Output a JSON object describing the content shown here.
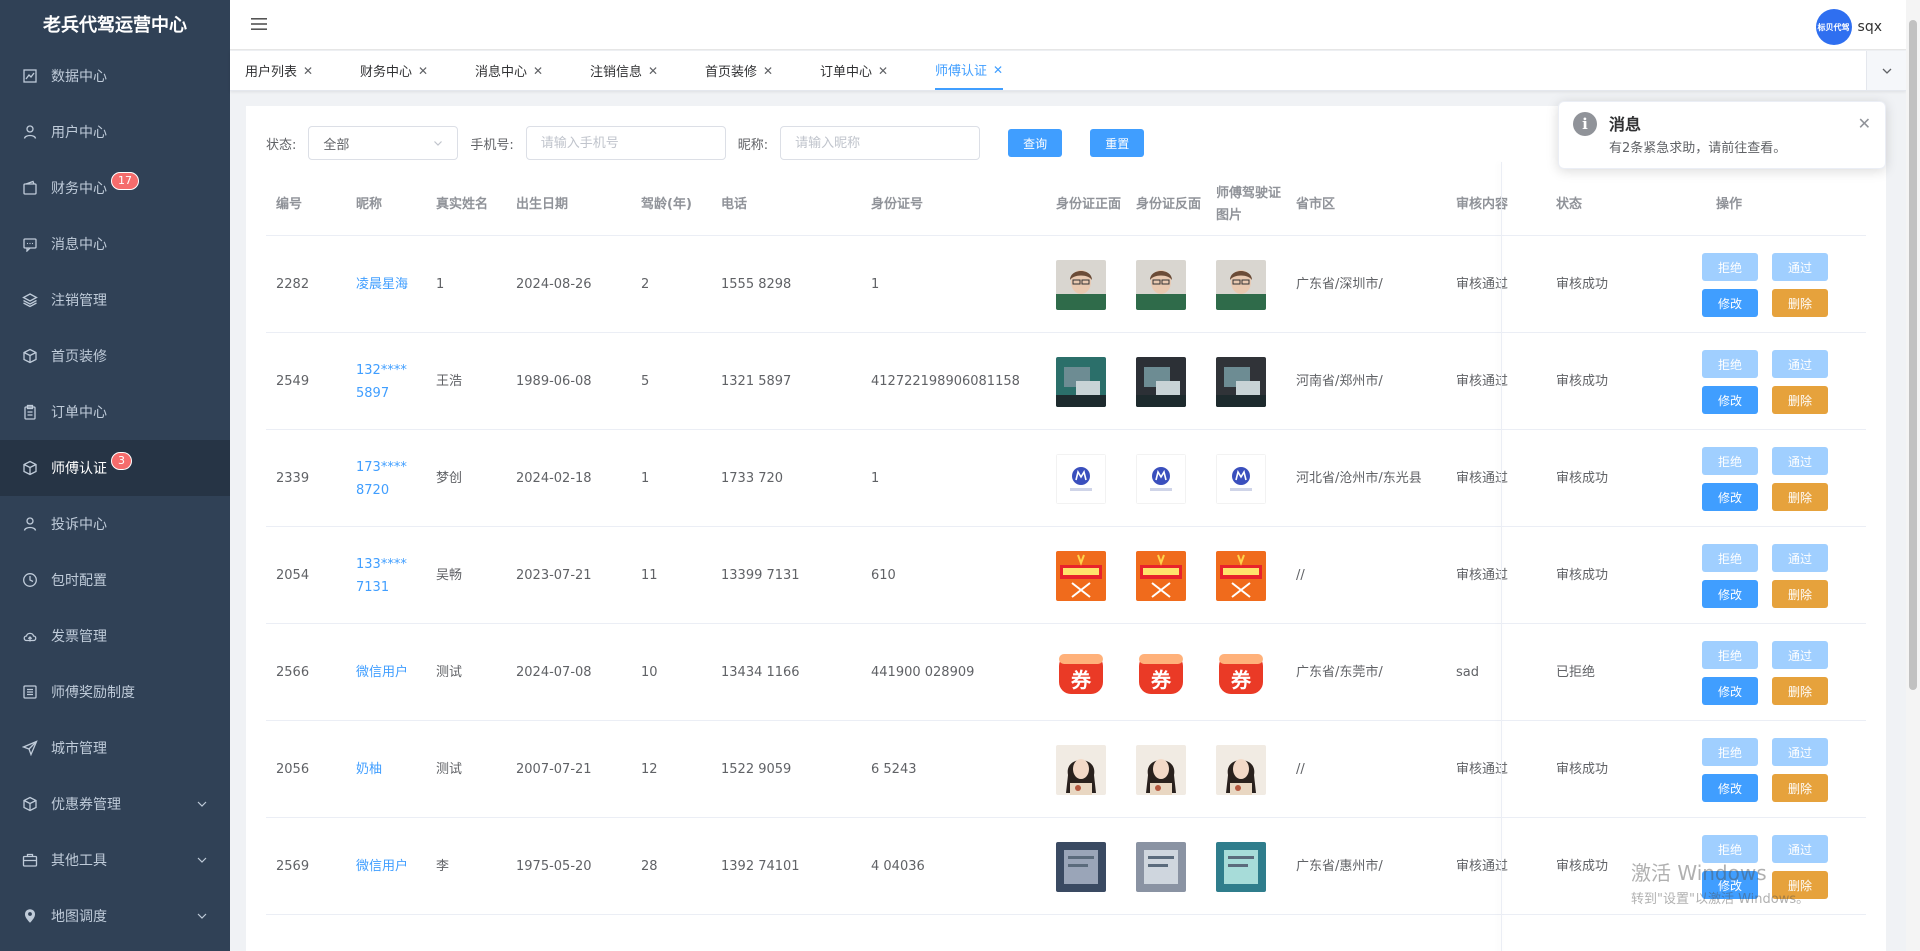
{
  "sidebar": {
    "logo": "老兵代驾运营中心",
    "items": [
      {
        "label": "数据中心",
        "icon": "chart-icon"
      },
      {
        "label": "用户中心",
        "icon": "user-icon"
      },
      {
        "label": "财务中心",
        "icon": "wallet-icon",
        "badge": "17"
      },
      {
        "label": "消息中心",
        "icon": "message-icon"
      },
      {
        "label": "注销管理",
        "icon": "layers-icon"
      },
      {
        "label": "首页装修",
        "icon": "box-icon"
      },
      {
        "label": "订单中心",
        "icon": "clipboard-icon"
      },
      {
        "label": "师傅认证",
        "icon": "box-icon",
        "badge": "3"
      },
      {
        "label": "投诉中心",
        "icon": "user-icon"
      },
      {
        "label": "包时配置",
        "icon": "clock-icon"
      },
      {
        "label": "发票管理",
        "icon": "cloud-icon"
      },
      {
        "label": "师傅奖励制度",
        "icon": "list-icon"
      },
      {
        "label": "城市管理",
        "icon": "send-icon"
      },
      {
        "label": "优惠券管理",
        "icon": "box-icon"
      },
      {
        "label": "其他工具",
        "icon": "briefcase-icon"
      },
      {
        "label": "地图调度",
        "icon": "location-icon"
      }
    ]
  },
  "header": {
    "username": "sqx",
    "avatar_text": "标贝代驾"
  },
  "tabs": [
    {
      "label": "用户列表"
    },
    {
      "label": "财务中心"
    },
    {
      "label": "消息中心"
    },
    {
      "label": "注销信息"
    },
    {
      "label": "首页装修"
    },
    {
      "label": "订单中心"
    },
    {
      "label": "师傅认证"
    }
  ],
  "filter": {
    "status_label": "状态:",
    "status_value": "全部",
    "phone_label": "手机号:",
    "phone_placeholder": "请输入手机号",
    "nick_label": "昵称:",
    "nick_placeholder": "请输入昵称",
    "query_btn": "查询",
    "reset_btn": "重置"
  },
  "table": {
    "columns": [
      "编号",
      "昵称",
      "真实姓名",
      "出生日期",
      "驾龄(年)",
      "电话",
      "身份证号",
      "身份证正面",
      "身份证反面",
      "师傅驾驶证图片",
      "省市区",
      "审核内容",
      "状态",
      "操作"
    ],
    "actions": {
      "reject": "拒绝",
      "pass": "通过",
      "edit": "修改",
      "delete": "删除"
    },
    "rows": [
      {
        "id": "2282",
        "nick": "凌晨星海",
        "name": "1",
        "birth": "2024-08-26",
        "years": "2",
        "phone": "1555  8298",
        "idno": "1",
        "region": "广东省/深圳市/",
        "review": "审核通过",
        "status": "审核成功",
        "img": "portrait"
      },
      {
        "id": "2549",
        "nick": "132****5897",
        "name": "王浩",
        "birth": "1989-06-08",
        "years": "5",
        "phone": "1321  5897",
        "idno": "412722198906081158",
        "region": "河南省/郑州市/",
        "review": "审核通过",
        "status": "审核成功",
        "img": "photo"
      },
      {
        "id": "2339",
        "nick": "173****8720",
        "name": "梦创",
        "birth": "2024-02-18",
        "years": "1",
        "phone": "1733  720",
        "idno": "1",
        "region": "河北省/沧州市/东光县",
        "review": "审核通过",
        "status": "审核成功",
        "img": "logo"
      },
      {
        "id": "2054",
        "nick": "133****7131",
        "name": "吴畅",
        "birth": "2023-07-21",
        "years": "11",
        "phone": "13399  7131",
        "idno": "610",
        "region": "//",
        "review": "审核通过",
        "status": "审核成功",
        "img": "poster"
      },
      {
        "id": "2566",
        "nick": "微信用户",
        "name": "测试",
        "birth": "2024-07-08",
        "years": "10",
        "phone": "13434  1166",
        "idno": "441900  028909",
        "region": "广东省/东莞市/",
        "review": "sad",
        "status": "已拒绝",
        "img": "coupon"
      },
      {
        "id": "2056",
        "nick": "奶柚",
        "name": "测试",
        "birth": "2007-07-21",
        "years": "12",
        "phone": "1522  9059",
        "idno": "6  5243",
        "region": "//",
        "review": "审核通过",
        "status": "审核成功",
        "img": "girl"
      },
      {
        "id": "2569",
        "nick": "微信用户",
        "name": "李",
        "birth": "1975-05-20",
        "years": "28",
        "phone": "1392  74101",
        "idno": "4  04036",
        "region": "广东省/惠州市/",
        "review": "审核通过",
        "status": "审核成功",
        "img": "doc"
      }
    ]
  },
  "notification": {
    "title": "消息",
    "message": "有2条紧急求助，请前往查看。"
  },
  "watermark": {
    "line1": "激活 Windows",
    "line2": "转到\"设置\"以激活 Windows。"
  }
}
